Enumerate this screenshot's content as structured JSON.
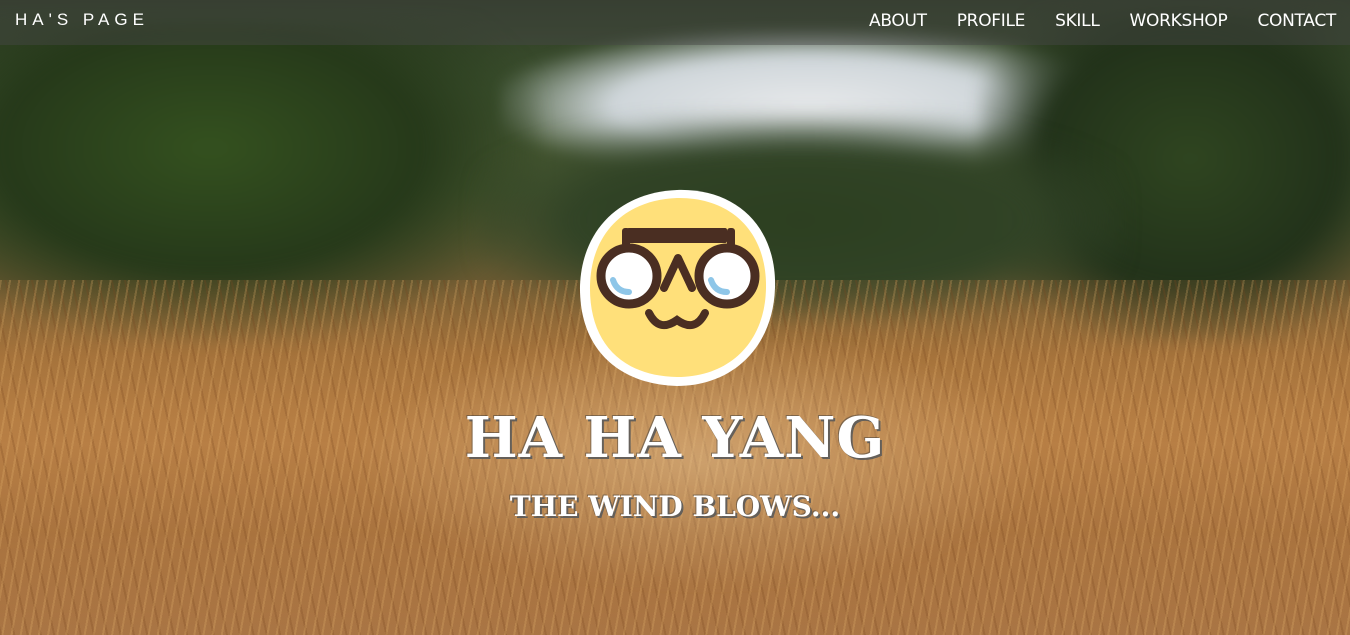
{
  "header": {
    "brand": "HA'S PAGE",
    "nav": [
      {
        "label": "ABOUT"
      },
      {
        "label": "PROFILE"
      },
      {
        "label": "SKILL"
      },
      {
        "label": "WORKSHOP"
      },
      {
        "label": "CONTACT"
      }
    ]
  },
  "hero": {
    "title": "HA HA YANG",
    "subtitle": "THE WIND BLOWS..."
  },
  "colors": {
    "avatar_face": "#ffe07a",
    "avatar_outline": "#4a2e22",
    "avatar_lens_highlight": "#8ec6e8",
    "navbar_bg": "rgba(70,70,70,0.45)"
  },
  "icons": {
    "avatar": "cartoon-face-with-glasses-icon"
  }
}
